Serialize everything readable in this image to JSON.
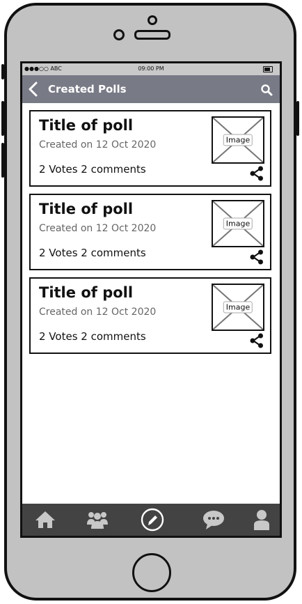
{
  "status_bar": {
    "carrier": "●●●○○ ABC",
    "time": "09:00 PM"
  },
  "header": {
    "title": "Created Polls",
    "back_icon": "back-chevron-icon",
    "search_icon": "search-icon"
  },
  "polls": [
    {
      "title": "Title of poll",
      "created": "Created on 12 Oct 2020",
      "stats": "2 Votes 2 comments",
      "image_label": "Image"
    },
    {
      "title": "Title of poll",
      "created": "Created on 12 Oct 2020",
      "stats": "2 Votes 2 comments",
      "image_label": "Image"
    },
    {
      "title": "Title of poll",
      "created": "Created on 12 Oct 2020",
      "stats": "2 Votes 2 comments",
      "image_label": "Image"
    }
  ],
  "tab_bar": {
    "items": [
      "home-icon",
      "people-icon",
      "edit-icon",
      "chat-icon",
      "profile-icon"
    ]
  },
  "colors": {
    "header_bg": "#787a86",
    "tab_bar_bg": "#434343",
    "phone_body": "#c2c2c2",
    "tab_icon": "#c8c8c8"
  }
}
